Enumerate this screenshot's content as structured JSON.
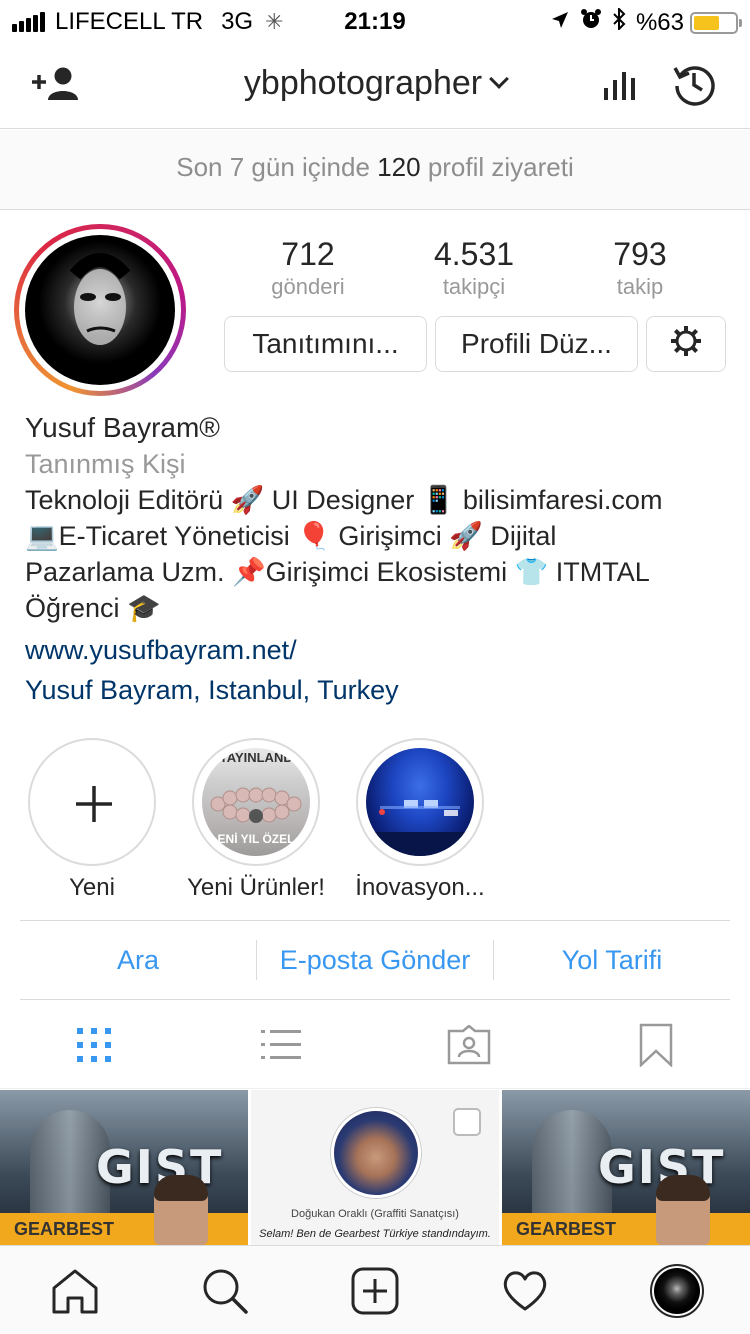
{
  "status_bar": {
    "carrier": "LIFECELL TR",
    "network": "3G",
    "time": "21:19",
    "battery_percent": "%63",
    "battery_level": 0.63
  },
  "nav": {
    "username": "ybphotographer"
  },
  "visits": {
    "prefix": "Son 7 gün içinde",
    "count": "120",
    "suffix": "profil ziyareti"
  },
  "stats": {
    "posts": {
      "value": "712",
      "label": "gönderi"
    },
    "followers": {
      "value": "4.531",
      "label": "takipçi"
    },
    "following": {
      "value": "793",
      "label": "takip"
    }
  },
  "buttons": {
    "promote": "Tanıtımını...",
    "edit_profile": "Profili Düz..."
  },
  "bio": {
    "name": "Yusuf Bayram®",
    "category": "Tanınmış Kişi",
    "text": "Teknoloji Editörü 🚀 UI Designer 📱 bilisimfaresi.com\n💻E-Ticaret Yöneticisi 🎈 Girişimci 🚀 Dijital\nPazarlama Uzm. 📌Girişimci Ekosistemi 👕 ITMTAL\nÖğrenci 🎓",
    "website": "www.yusufbayram.net/",
    "location": "Yusuf Bayram, Istanbul, Turkey"
  },
  "highlights": [
    {
      "label": "Yeni",
      "icon": "plus-icon"
    },
    {
      "label": "Yeni Ürünler!",
      "overlay_top": "YAYINLAND",
      "overlay_bottom": "ENİ YIL ÖZEL"
    },
    {
      "label": "İnovasyon..."
    }
  ],
  "contact": {
    "call": "Ara",
    "email": "E-posta Gönder",
    "directions": "Yol Tarifi"
  },
  "posts": [
    {
      "logo": "GIST",
      "banner": "GEARBEST"
    },
    {
      "caption_name": "Doğukan Oraklı",
      "caption_role": "(Graffiti Sanatçısı)",
      "caption_text": "Selam! Ben de Gearbest Türkiye standındayım."
    },
    {
      "logo": "GIST",
      "banner": "GEARBEST"
    }
  ],
  "colors": {
    "link": "#003569",
    "accent": "#3897f0",
    "muted": "#999999",
    "border": "#dbdbdb",
    "battery": "#f6c31c"
  }
}
